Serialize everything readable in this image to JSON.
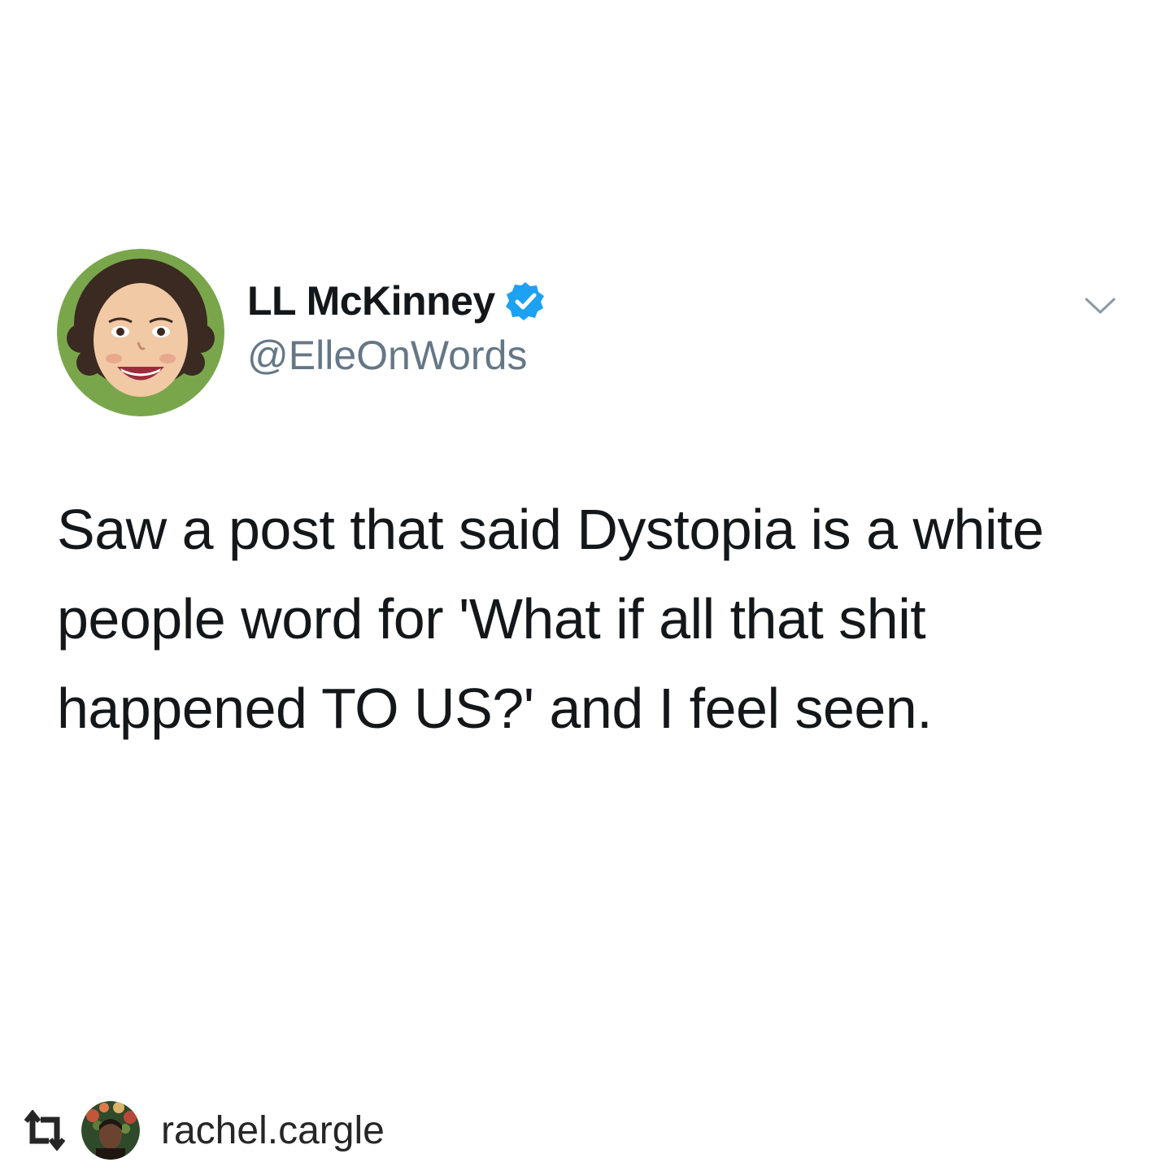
{
  "tweet": {
    "display_name": "LL McKinney",
    "handle": "@ElleOnWords",
    "text": "Saw a post that said Dystopia is a white people word for 'What if all that shit happened TO US?' and I feel seen.",
    "verified": true,
    "avatar_icon": "cartoon-avatar-icon",
    "menu_icon": "chevron-down-icon"
  },
  "repost": {
    "icon": "repost-icon",
    "username": "rachel.cargle",
    "avatar_icon": "profile-avatar-icon"
  },
  "colors": {
    "background": "#ffffff",
    "name": "#14171a",
    "handle": "#657786",
    "verified_badge": "#1da1f2",
    "avatar_ring": "#7aa64b"
  }
}
